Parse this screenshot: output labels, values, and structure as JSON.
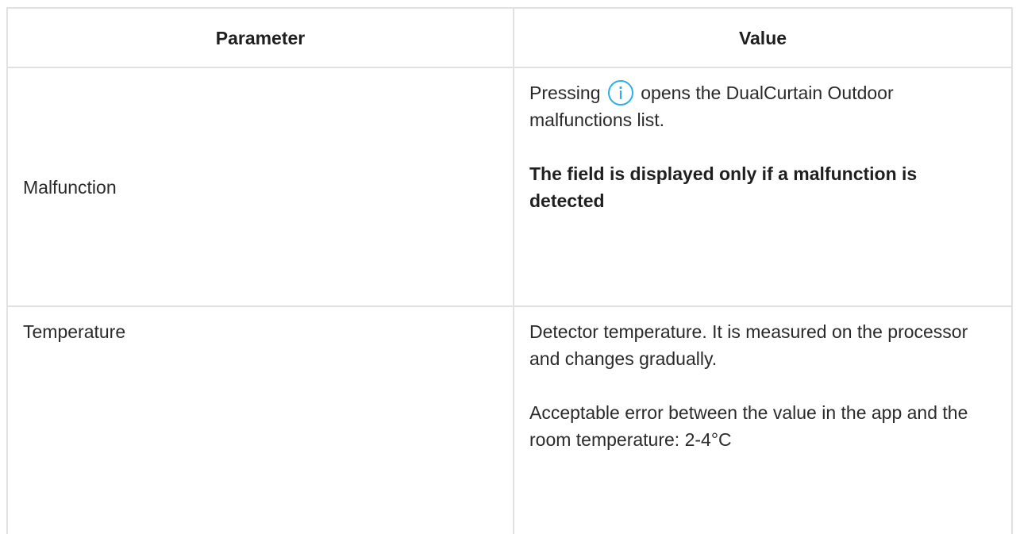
{
  "table": {
    "headers": {
      "parameter": "Parameter",
      "value": "Value"
    },
    "rows": [
      {
        "parameter": "Malfunction",
        "value_prefix": "Pressing",
        "value_suffix": " opens the DualCurtain Outdoor malfunctions list.",
        "note": "The field is displayed only if a malfunction is detected"
      },
      {
        "parameter": "Temperature",
        "value_line1": "Detector temperature. It is measured on the processor and changes gradually.",
        "value_line2": "Acceptable error between the value in the app and the room temperature: 2-4°C"
      }
    ]
  },
  "icons": {
    "info": "info-icon",
    "info_color": "#2eaee6"
  }
}
